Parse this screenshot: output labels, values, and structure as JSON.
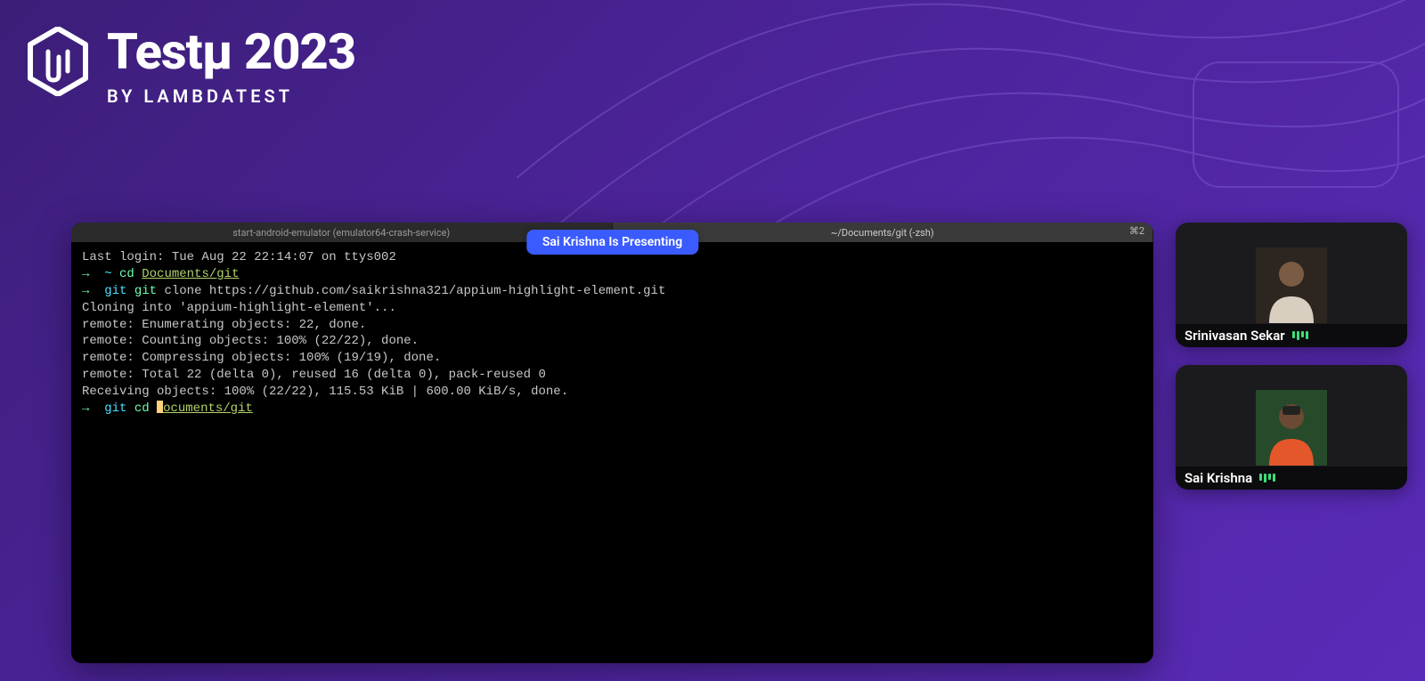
{
  "header": {
    "title": "Testµ 2023",
    "subtitle": "BY LAMBDATEST"
  },
  "presenting_badge": "Sai Krishna Is Presenting",
  "terminal": {
    "tab_left": "start-android-emulator (emulator64-crash-service)",
    "tab_right": "~/Documents/git (-zsh)",
    "tab_count": "⌘2",
    "last_login": "Last login: Tue Aug 22 22:14:07 on ttys002",
    "line1_prompt": "→",
    "line1_tilde": "~",
    "line1_cmd": "cd",
    "line1_dir": "Documents/git",
    "line2_prompt": "→",
    "line2_branch": "git",
    "line2_cmd": "git",
    "line2_rest": " clone https://github.com/saikrishna321/appium-highlight-element.git",
    "out1": "Cloning into 'appium-highlight-element'...",
    "out2": "remote: Enumerating objects: 22, done.",
    "out3": "remote: Counting objects: 100% (22/22), done.",
    "out4": "remote: Compressing objects: 100% (19/19), done.",
    "out5": "remote: Total 22 (delta 0), reused 16 (delta 0), pack-reused 0",
    "out6": "Receiving objects: 100% (22/22), 115.53 KiB | 600.00 KiB/s, done.",
    "line3_prompt": "→",
    "line3_branch": "git",
    "line3_cmd": "cd",
    "line3_dir": "ocuments/git"
  },
  "participants": [
    {
      "name": "Srinivasan Sekar"
    },
    {
      "name": "Sai Krishna"
    }
  ]
}
